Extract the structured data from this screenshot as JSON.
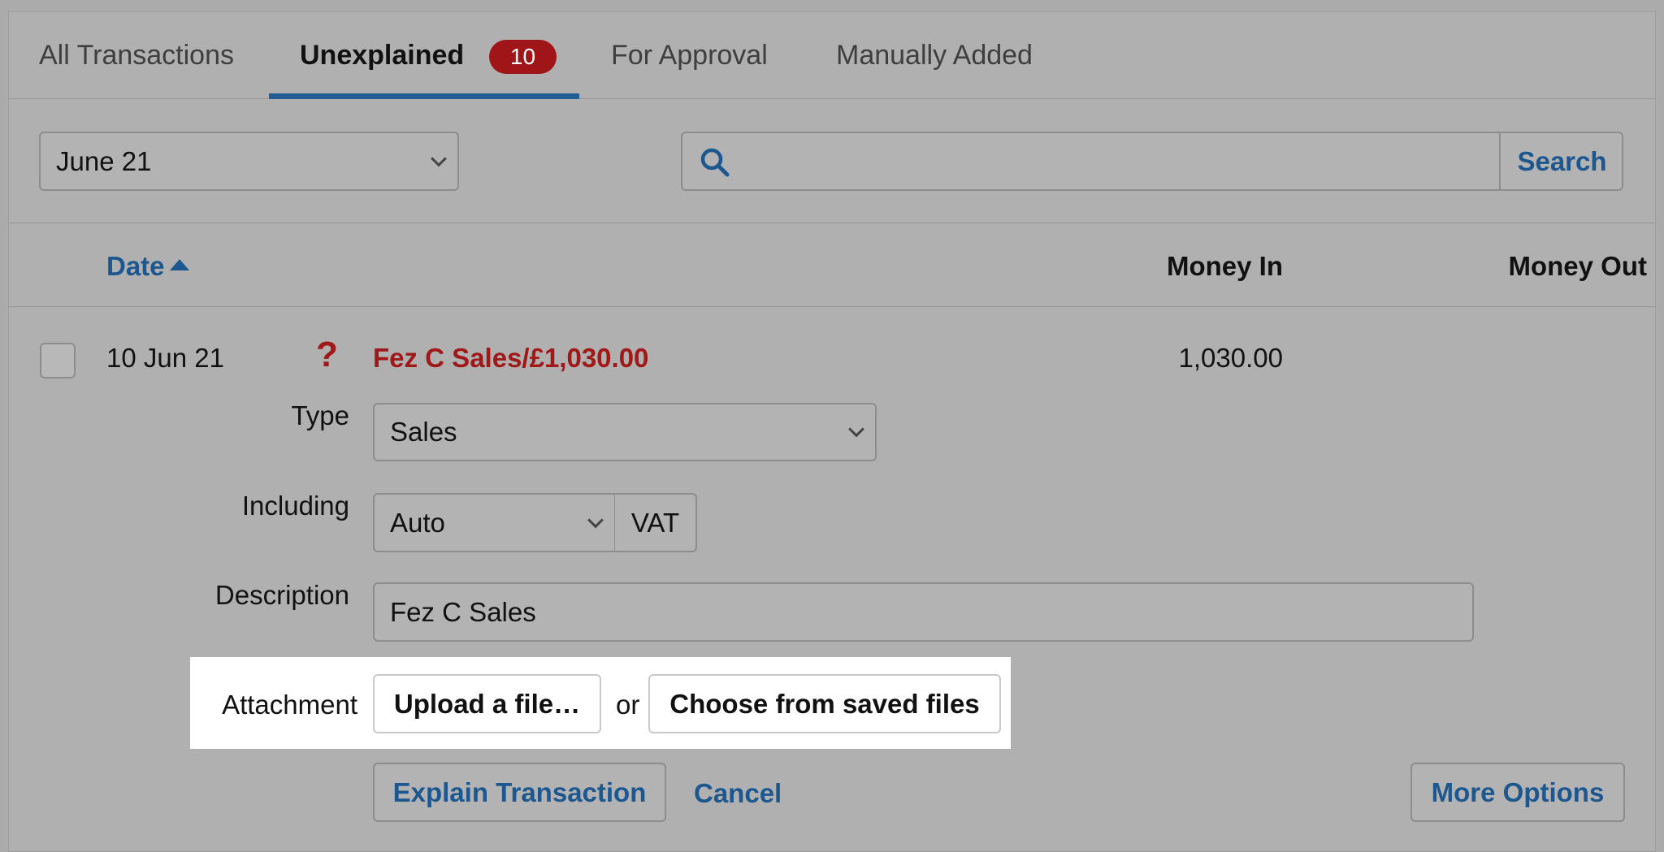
{
  "tabs": {
    "all": "All Transactions",
    "unexplained": "Unexplained",
    "unexplained_count": "10",
    "for_approval": "For Approval",
    "manually_added": "Manually Added"
  },
  "filters": {
    "month_select": "June 21",
    "search_value": "",
    "search_button": "Search"
  },
  "table": {
    "headers": {
      "date": "Date",
      "money_in": "Money In",
      "money_out": "Money Out"
    },
    "row": {
      "date": "10 Jun 21",
      "status_icon": "?",
      "title": "Fez C Sales/£1,030.00",
      "money_in": "1,030.00"
    }
  },
  "form": {
    "type_label": "Type",
    "type_value": "Sales",
    "including_label": "Including",
    "including_value": "Auto",
    "vat_label": "VAT",
    "description_label": "Description",
    "description_value": "Fez C Sales",
    "attachment_label": "Attachment",
    "upload_button": "Upload a file…",
    "or_text": "or",
    "choose_saved_button": "Choose from saved files",
    "explain_button": "Explain Transaction",
    "cancel_link": "Cancel",
    "more_options_button": "More Options"
  },
  "colors": {
    "accent": "#1d5790",
    "alert": "#a01818",
    "badge": "#9f1518"
  }
}
